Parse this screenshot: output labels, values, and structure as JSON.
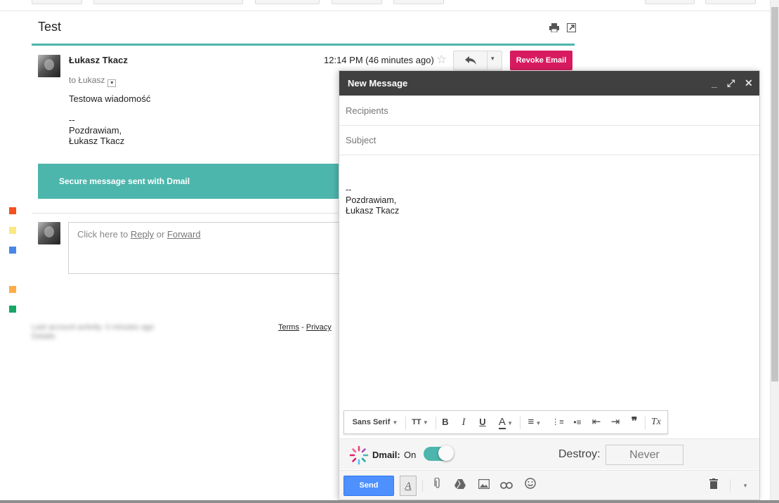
{
  "thread": {
    "subject": "Test",
    "print_icon": "printer-icon",
    "popout_icon": "new-window-icon"
  },
  "message": {
    "sender": "Łukasz Tkacz",
    "to_label": "to Łukasz",
    "time": "12:14 PM (46 minutes ago)",
    "star_icon": "☆",
    "reply_icon": "reply-icon",
    "more_icon": "▾",
    "revoke_label": "Revoke Email",
    "body_line1": "Testowa wiadomość",
    "sig_dash": "--",
    "sig_greeting": "Pozdrawiam,",
    "sig_name": "Łukasz Tkacz",
    "secure_banner": "Secure message sent with Dmail"
  },
  "reply_box": {
    "prefix": "Click here to ",
    "reply": "Reply",
    "or": " or ",
    "forward": "Forward"
  },
  "footer": {
    "terms": "Terms",
    "dash": " - ",
    "privacy": "Privacy",
    "blurred_line1": "Last account activity: 0 minutes ago",
    "blurred_line2": "Details"
  },
  "labels": {
    "colors": [
      "#f4511e",
      "#fce883",
      "#4a86e8",
      "#ffad47",
      "#16a765"
    ]
  },
  "compose": {
    "title": "New Message",
    "minimize_icon": "_",
    "maximize_icon": "⤢",
    "close_icon": "✕",
    "recipients_placeholder": "Recipients",
    "subject_placeholder": "Subject",
    "sig_dash": "--",
    "sig_greeting": "Pozdrawiam,",
    "sig_name": "Łukasz Tkacz",
    "format": {
      "font": "Sans Serif",
      "size_icon": "TT",
      "bold": "B",
      "italic": "I",
      "underline": "U",
      "text_color": "A",
      "align": "≡",
      "numbered": "⋮≡",
      "bulleted": "•≡",
      "indent_less": "⇤",
      "indent_more": "⇥",
      "quote": "❞",
      "clear": "Tx"
    },
    "dmail": {
      "label": "Dmail:",
      "state": "On",
      "toggle_on": true,
      "destroy_label": "Destroy:",
      "destroy_value": "Never"
    },
    "send_label": "Send",
    "toolbar_icons": [
      "formatting-icon",
      "attach-icon",
      "drive-icon",
      "photo-icon",
      "link-icon",
      "emoji-icon"
    ],
    "discard_icon": "trash-icon",
    "more_icon": "▾"
  }
}
